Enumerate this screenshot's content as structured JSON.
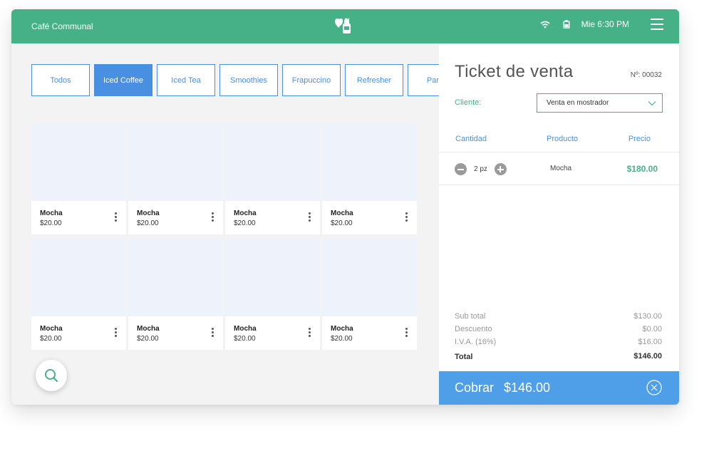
{
  "topbar": {
    "app_title": "Café Communal",
    "clock": "Mie 6:30 PM",
    "color": "#46b186"
  },
  "categories": [
    "Todos",
    "Iced Coffee",
    "Iced Tea",
    "Smoothies",
    "Frapuccino",
    "Refresher",
    "Panni"
  ],
  "active_category": "Iced Coffee",
  "products": [
    {
      "name": "Mocha",
      "price": "$20.00"
    },
    {
      "name": "Mocha",
      "price": "$20.00"
    },
    {
      "name": "Mocha",
      "price": "$20.00"
    },
    {
      "name": "Mocha",
      "price": "$20.00"
    },
    {
      "name": "Mocha",
      "price": "$20.00"
    },
    {
      "name": "Mocha",
      "price": "$20.00"
    },
    {
      "name": "Mocha",
      "price": "$20.00"
    },
    {
      "name": "Mocha",
      "price": "$20.00"
    }
  ],
  "ticket": {
    "title": "Ticket de venta",
    "number": "Nº: 00032",
    "client_label": "Cliente:",
    "client_value": "Venta en mostrador",
    "columns": {
      "qty": "Cantidad",
      "product": "Producto",
      "price": "Precio"
    },
    "lines": [
      {
        "qty": "2 pz",
        "product": "Mocha",
        "price": "$180.00"
      }
    ],
    "summary": {
      "subtotal_label": "Sub total",
      "subtotal": "$130.00",
      "discount_label": "Descuento",
      "discount": "$0.00",
      "tax_label": "I.V.A. (16%)",
      "tax": "$16.00",
      "total_label": "Total",
      "total": "$146.00"
    },
    "charge_label": "Cobrar",
    "charge_amount": "$146.00"
  },
  "icons": [
    "logo-icon",
    "wifi-icon",
    "battery-icon",
    "hamburger-menu-icon",
    "more-vertical-icon",
    "search-icon",
    "minus-icon",
    "plus-icon",
    "chevron-down-icon",
    "close-circle-icon"
  ]
}
